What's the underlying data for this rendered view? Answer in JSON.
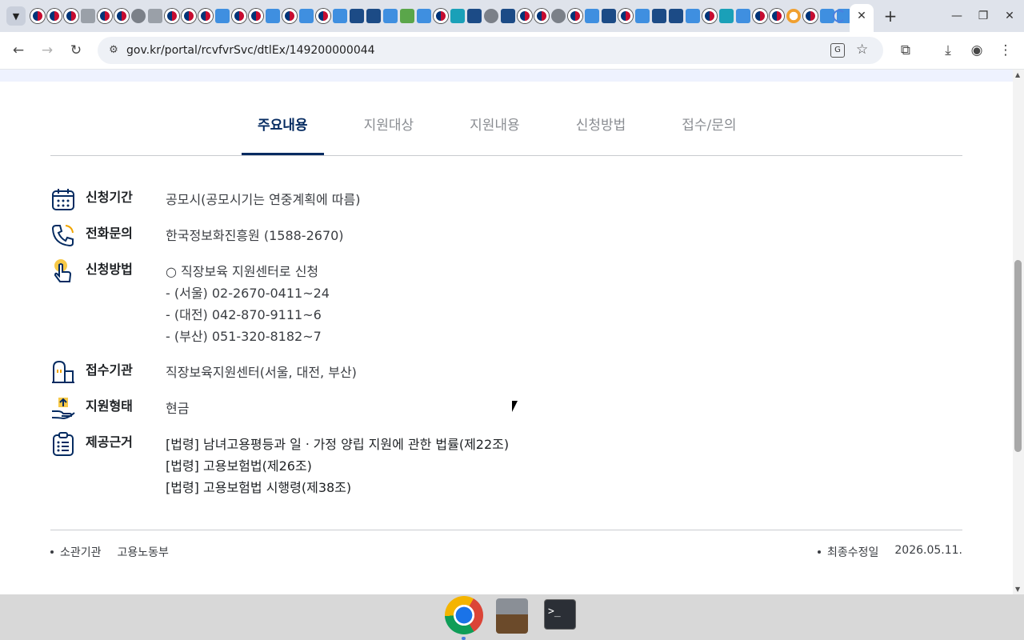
{
  "browser": {
    "url": "gov.kr/portal/rcvfvrSvc/dtlEx/149200000044",
    "tab_menu_icon": "chevron-down-icon",
    "tab_close": "✕",
    "new_tab": "+",
    "window_controls": [
      "minimize",
      "maximize",
      "close"
    ],
    "icons": [
      "back-icon",
      "forward-icon",
      "reload-icon",
      "site-info-icon",
      "translate-icon",
      "bookmark-star-icon",
      "extensions-icon",
      "download-icon",
      "profile-icon",
      "menu-icon"
    ]
  },
  "page": {
    "tabs": [
      {
        "label": "주요내용",
        "active": true
      },
      {
        "label": "지원대상",
        "active": false
      },
      {
        "label": "지원내용",
        "active": false
      },
      {
        "label": "신청방법",
        "active": false
      },
      {
        "label": "접수/문의",
        "active": false
      }
    ],
    "info": {
      "period": {
        "label": "신청기간",
        "value": "공모시(공모시기는 연중계획에 따름)",
        "icon": "calendar-icon"
      },
      "phone": {
        "label": "전화문의",
        "value": "한국정보화진흥원 (1588-2670)",
        "icon": "phone-icon"
      },
      "method": {
        "label": "신청방법",
        "lines": [
          "○ 직장보육 지원센터로 신청",
          "- (서울) 02-2670-0411~24",
          "- (대전) 042-870-9111~6",
          "- (부산) 051-320-8182~7"
        ],
        "icon": "hand-pointer-icon"
      },
      "agency": {
        "label": "접수기관",
        "value": "직장보육지원센터(서울, 대전, 부산)",
        "icon": "building-icon"
      },
      "type": {
        "label": "지원형태",
        "value": "현금",
        "icon": "hand-money-icon"
      },
      "basis": {
        "label": "제공근거",
        "lines": [
          "[법령] 남녀고용평등과 일ㆍ가정 양립 지원에 관한 법률(제22조)",
          "[법령] 고용보험법(제26조)",
          "[법령] 고용보험법 시행령(제38조)"
        ],
        "icon": "clipboard-list-icon"
      }
    },
    "footer": {
      "agency_label": "소관기관",
      "agency_value": "고용노동부",
      "updated_label": "최종수정일",
      "updated_value": "2026.05.11."
    }
  },
  "taskbar": {
    "apps": [
      "chrome-icon",
      "files-icon",
      "terminal-icon"
    ],
    "terminal_glyph": ">_"
  }
}
